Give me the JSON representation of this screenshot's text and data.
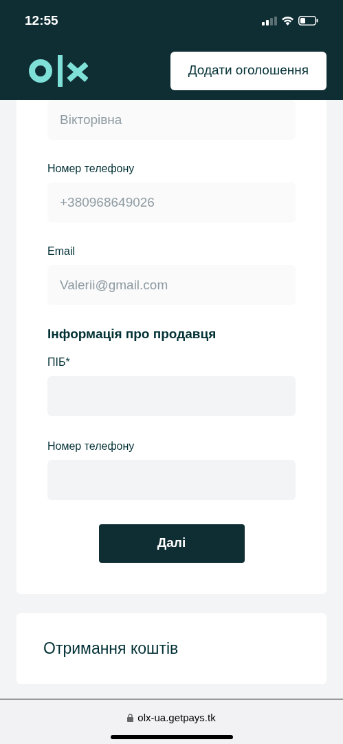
{
  "status_bar": {
    "time": "12:55"
  },
  "header": {
    "button": "Додати оголошення"
  },
  "form": {
    "top_field": {
      "value": "Вікторівна"
    },
    "fields": [
      {
        "label": "Номер телефону",
        "value": "+380968649026"
      },
      {
        "label": "Email",
        "value": "Valerii@gmail.com"
      }
    ],
    "section_title": "Інформація про продавця",
    "seller_fields": [
      {
        "label": "ПІБ*"
      },
      {
        "label": "Номер телефону"
      }
    ],
    "next_button": "Далі"
  },
  "payout_card": {
    "title": "Отримання коштів"
  },
  "browser_bar": {
    "url": "olx-ua.getpays.tk"
  }
}
